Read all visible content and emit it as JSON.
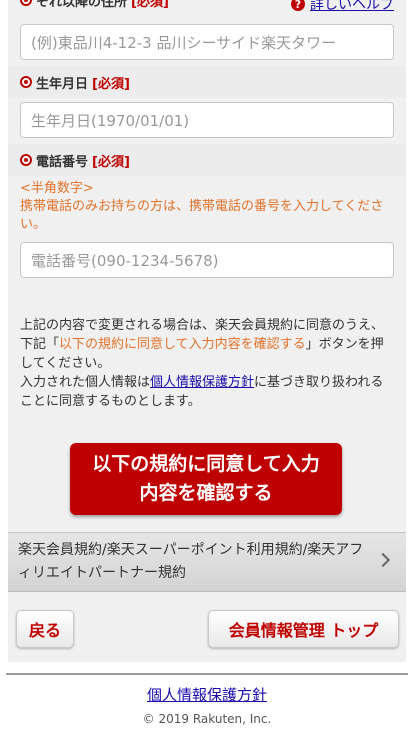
{
  "address": {
    "label": "それ以降の住所",
    "required": "[必須]",
    "help_link": "詳しいヘルプ",
    "placeholder": "(例)東品川4-12-3 品川シーサイド楽天タワー"
  },
  "birthday": {
    "label": "生年月日",
    "required": "[必須]",
    "placeholder": "生年月日(1970/01/01)"
  },
  "phone": {
    "label": "電話番号",
    "required": "[必須]",
    "hint_type": "<半角数字>",
    "hint_mobile": "携帯電話のみお持ちの方は、携帯電話の番号を入力してください。",
    "placeholder": "電話番号(090-1234-5678)"
  },
  "agreement": {
    "line1": "上記の内容で変更される場合は、楽天会員規約に同意のうえ、",
    "line2_prefix": "下記「",
    "line2_highlight": "以下の規約に同意して入力内容を確認する",
    "line2_suffix": "」ボタンを押してください。",
    "line3_prefix": "入力された個人情報は",
    "line3_link": "個人情報保護方針",
    "line3_suffix": "に基づき取り扱われることに同意するものとします。"
  },
  "confirm_button": "以下の規約に同意して入力内容を確認する",
  "terms_link": "楽天会員規約/楽天スーパーポイント利用規約/楽天アフィリエイトパートナー規約",
  "nav": {
    "back": "戻る",
    "top": "会員情報管理 トップ"
  },
  "footer": {
    "privacy_link": "個人情報保護方針",
    "copyright": "© 2019 Rakuten, Inc."
  },
  "colors": {
    "brand_red": "#bf0000",
    "hint_orange": "#e2722a",
    "link_blue": "#1a0dab"
  }
}
